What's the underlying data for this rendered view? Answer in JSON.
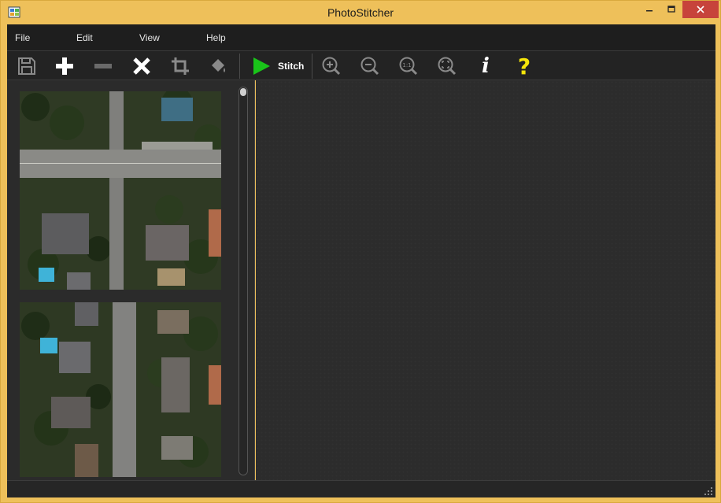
{
  "window": {
    "title": "PhotoStitcher"
  },
  "menu": {
    "items": [
      "File",
      "Edit",
      "View",
      "Help"
    ]
  },
  "toolbar": {
    "save": "save-icon",
    "add": "plus-icon",
    "remove": "minus-icon",
    "delete": "x-icon",
    "crop": "crop-icon",
    "fill": "paint-bucket-icon",
    "stitch_label": "Stitch",
    "zoom_in": "zoom-in-icon",
    "zoom_out": "zoom-out-icon",
    "zoom_actual": "1:1",
    "zoom_fit": "zoom-fit-icon",
    "info": "i",
    "help": "?"
  },
  "colors": {
    "frame": "#eec05a",
    "close": "#c7433b",
    "stitch_green": "#19c419",
    "help_yellow": "#f5e50a",
    "panel_bg": "#2b2b2b"
  },
  "thumbnails": [
    {
      "name": "aerial-image-1"
    },
    {
      "name": "aerial-image-2"
    }
  ]
}
